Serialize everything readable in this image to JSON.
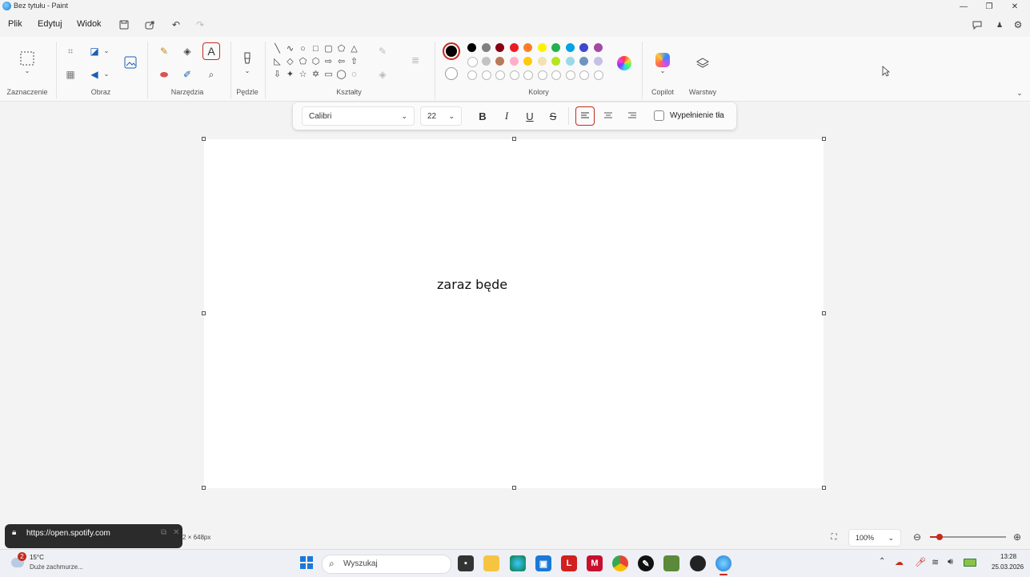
{
  "window": {
    "title": "Bez tytułu - Paint"
  },
  "menu": {
    "file": "Plik",
    "edit": "Edytuj",
    "view": "Widok"
  },
  "ribbon": {
    "groups": {
      "selection": "Zaznaczenie",
      "image": "Obraz",
      "tools": "Narzędzia",
      "brushes": "Pędzle",
      "shapes": "Kształty",
      "colors": "Kolory",
      "copilot": "Copilot",
      "layers": "Warstwy"
    },
    "palette_row1": [
      "#000000",
      "#7f7f7f",
      "#880015",
      "#ed1c24",
      "#ff7f27",
      "#fff200",
      "#22b14c",
      "#00a2e8",
      "#3f48cc",
      "#a349a4"
    ],
    "palette_row2": [
      "#ffffff",
      "#c3c3c3",
      "#b97a57",
      "#ffaec9",
      "#ffc90e",
      "#efe4b0",
      "#b5e61d",
      "#99d9ea",
      "#7092be",
      "#c8bfe7"
    ],
    "active_color": "#000000",
    "accent": "#c42b1c"
  },
  "text_toolbar": {
    "font": "Calibri",
    "size": "22",
    "bold": "B",
    "italic": "I",
    "underline": "U",
    "strike": "S",
    "fill_label": "Wypełnienie tła"
  },
  "canvas": {
    "text": "zaraz będe"
  },
  "status": {
    "dimensions": "2 × 648px",
    "zoom": "100%",
    "zoom_level": 0.13
  },
  "spotify_popup": {
    "url": "https://open.spotify.com"
  },
  "taskbar": {
    "weather_temp": "15°C",
    "weather_desc": "Duże zachmurze...",
    "weather_badge": "2",
    "search_placeholder": "Wyszukaj",
    "time": "13:28",
    "date": "25.03.2026"
  }
}
